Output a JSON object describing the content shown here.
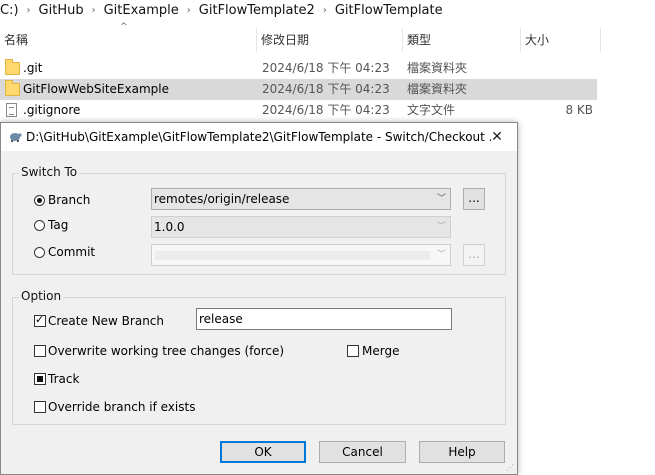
{
  "breadcrumb": [
    "C:)",
    "GitHub",
    "GitExample",
    "GitFlowTemplate2",
    "GitFlowTemplate"
  ],
  "columns": {
    "name": "名稱",
    "modified": "修改日期",
    "type": "類型",
    "size": "大小"
  },
  "files": [
    {
      "name": ".git",
      "modified": "2024/6/18 下午 04:23",
      "type": "檔案資料夾",
      "size": "",
      "icon": "folder-icon"
    },
    {
      "name": "GitFlowWebSiteExample",
      "modified": "2024/6/18 下午 04:23",
      "type": "檔案資料夾",
      "size": "",
      "icon": "folder-icon"
    },
    {
      "name": ".gitignore",
      "modified": "2024/6/18 下午 04:23",
      "type": "文字文件",
      "size": "8 KB",
      "icon": "text-file-icon"
    }
  ],
  "dialog": {
    "title": "D:\\GitHub\\GitExample\\GitFlowTemplate2\\GitFlowTemplate - Switch/Checkout ...",
    "close_label": "✕",
    "switch_to": {
      "label": "Switch To",
      "branch_label": "Branch",
      "branch_value": "remotes/origin/release",
      "tag_label": "Tag",
      "tag_value": "1.0.0",
      "commit_label": "Commit",
      "commit_value": "",
      "browse_label": "...",
      "selected": "Branch"
    },
    "option": {
      "label": "Option",
      "create_new_branch_label": "Create New Branch",
      "create_new_branch_checked": true,
      "new_branch_value": "release",
      "overwrite_label": "Overwrite working tree changes (force)",
      "overwrite_checked": false,
      "merge_label": "Merge",
      "merge_checked": false,
      "track_label": "Track",
      "track_state": "indeterminate",
      "override_label": "Override branch if exists",
      "override_checked": false
    },
    "buttons": {
      "ok": "OK",
      "cancel": "Cancel",
      "help": "Help"
    }
  }
}
